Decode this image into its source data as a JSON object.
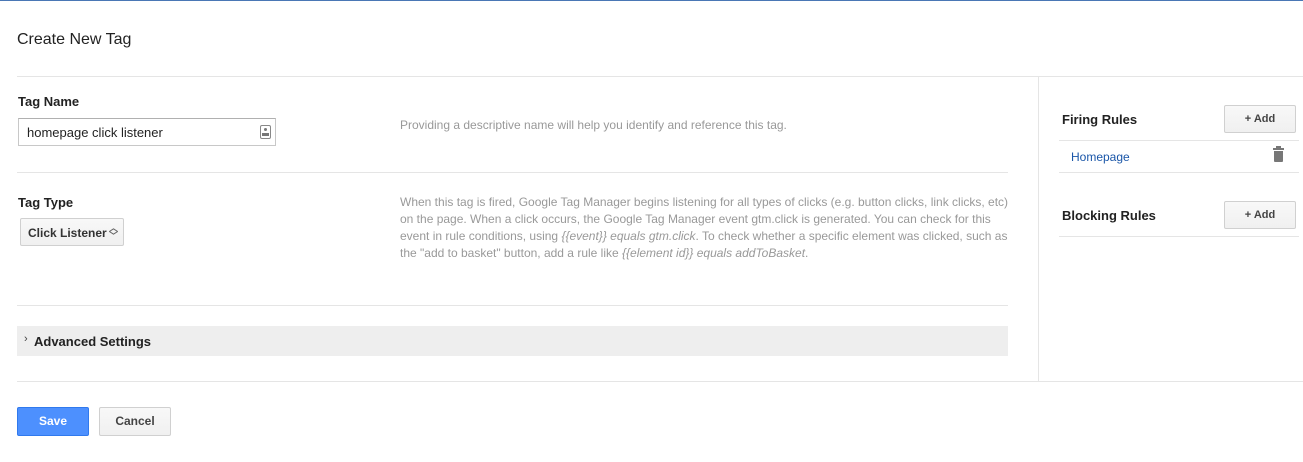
{
  "header": {
    "title": "Create New Tag"
  },
  "tag_name": {
    "label": "Tag Name",
    "value": "homepage click listener",
    "help": "Providing a descriptive name will help you identify and reference this tag."
  },
  "tag_type": {
    "label": "Tag Type",
    "selected": "Click Listener",
    "help": {
      "part1": "When this tag is fired, Google Tag Manager begins listening for all types of clicks (e.g. button clicks, link clicks, etc) on the page. When a click occurs, the Google Tag Manager event gtm.click is generated. You can check for this event in rule conditions, using ",
      "code1": "{{event}} equals gtm.click",
      "part2": ". To check whether a specific element was clicked, such as the \"add to basket\" button, add a rule like ",
      "code2": "{{element id}} equals addToBasket",
      "part3": "."
    }
  },
  "advanced": {
    "label": "Advanced Settings"
  },
  "rules": {
    "firing_label": "Firing Rules",
    "blocking_label": "Blocking Rules",
    "add_label": "+ Add",
    "firing_items": [
      "Homepage"
    ]
  },
  "footer": {
    "save_label": "Save",
    "cancel_label": "Cancel"
  },
  "colors": {
    "primary": "#4d90fe",
    "link": "#1a56a8",
    "help_text": "#999999"
  }
}
